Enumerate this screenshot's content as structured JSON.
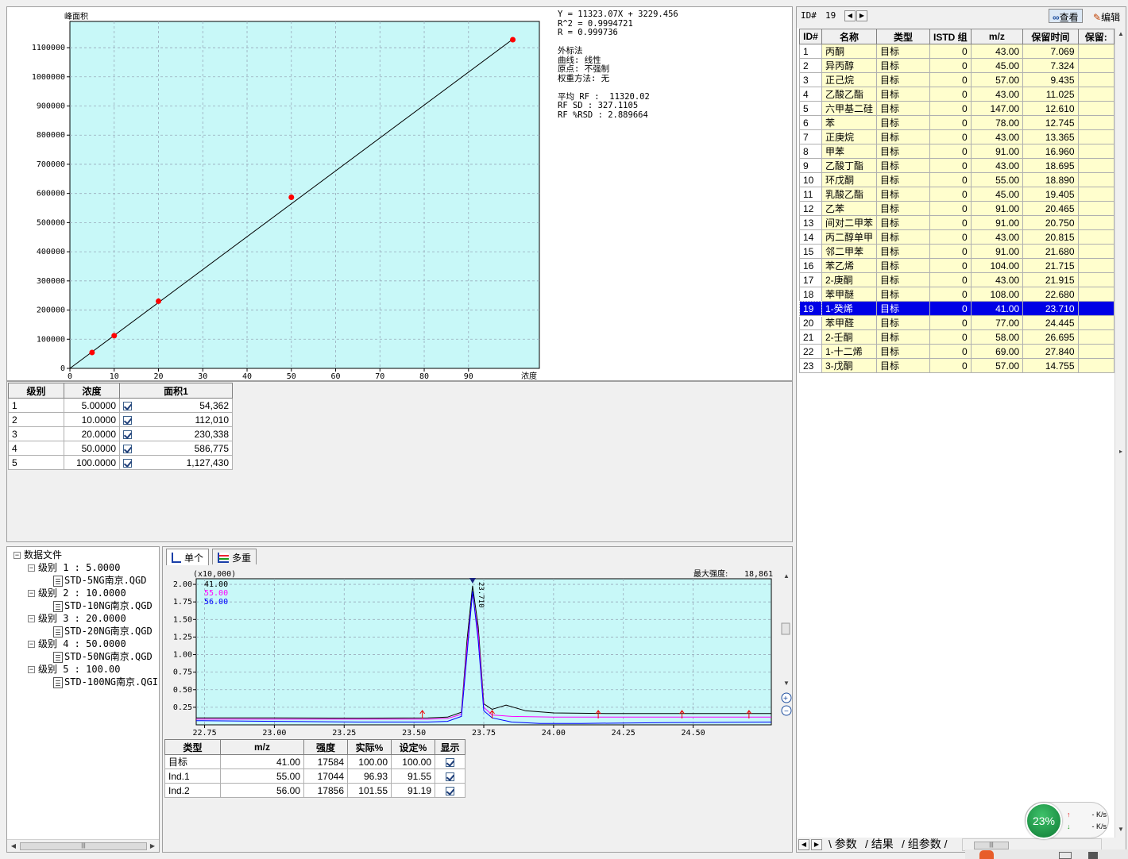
{
  "cal_chart": {
    "chart_data": {
      "type": "scatter",
      "ylabel": "峰面积",
      "xlabel": "浓度",
      "x_ticks": [
        "0",
        "10",
        "20",
        "30",
        "40",
        "50",
        "60",
        "70",
        "80",
        "90"
      ],
      "y_ticks": [
        "0",
        "100000",
        "200000",
        "300000",
        "400000",
        "500000",
        "600000",
        "700000",
        "800000",
        "900000",
        "1000000",
        "1100000"
      ],
      "xlim": [
        0,
        106
      ],
      "ylim": [
        0,
        1190000
      ],
      "grid": true,
      "points": [
        {
          "x": 5,
          "y": 54362
        },
        {
          "x": 10,
          "y": 112010
        },
        {
          "x": 20,
          "y": 230338
        },
        {
          "x": 50,
          "y": 586775
        },
        {
          "x": 100,
          "y": 1127430
        }
      ],
      "fit_line": {
        "slope": 11323.07,
        "intercept": -3229.456
      },
      "point_color": "#ff0000",
      "background_color": "#c8f8f8"
    }
  },
  "equation_info": [
    "Y = 11323.07X + 3229.456",
    "R^2 = 0.9994721",
    "R = 0.999736",
    "",
    "外标法",
    "曲线: 线性",
    "原点: 不强制",
    "权重方法: 无",
    "",
    "平均 RF :  11320.02",
    "RF SD : 327.1105",
    "RF %RSD : 2.889664"
  ],
  "level_table": {
    "headers": [
      "级别",
      "浓度",
      "面积1"
    ],
    "rows": [
      {
        "level": "1",
        "conc": "5.00000",
        "area": "54,362",
        "checked": true
      },
      {
        "level": "2",
        "conc": "10.0000",
        "area": "112,010",
        "checked": true
      },
      {
        "level": "3",
        "conc": "20.0000",
        "area": "230,338",
        "checked": true
      },
      {
        "level": "4",
        "conc": "50.0000",
        "area": "586,775",
        "checked": true
      },
      {
        "level": "5",
        "conc": "100.0000",
        "area": "1,127,430",
        "checked": true
      }
    ]
  },
  "tree": {
    "root": "数据文件",
    "levels": [
      {
        "label": "级别 1 : 5.0000",
        "file": "STD-5NG南京.QGD"
      },
      {
        "label": "级别 2 : 10.0000",
        "file": "STD-10NG南京.QGD"
      },
      {
        "label": "级别 3 : 20.0000",
        "file": "STD-20NG南京.QGD"
      },
      {
        "label": "级别 4 : 50.0000",
        "file": "STD-50NG南京.QGD"
      },
      {
        "label": "级别 5 : 100.00",
        "file": "STD-100NG南京.QGI"
      }
    ]
  },
  "chrom": {
    "tabs": [
      "单个",
      "多重"
    ],
    "scale_label": "(x10,000)",
    "max_intensity_label": "最大强度:",
    "max_intensity_value": "18,861",
    "peak_label": "23.710",
    "chart_data": {
      "type": "line",
      "xlim": [
        22.72,
        24.78
      ],
      "ylim": [
        0,
        2.08
      ],
      "x_ticks": [
        "22.75",
        "23.00",
        "23.25",
        "23.50",
        "23.75",
        "24.00",
        "24.25",
        "24.50"
      ],
      "y_ticks": [
        "0.25",
        "0.50",
        "0.75",
        "1.00",
        "1.25",
        "1.50",
        "1.75",
        "2.00"
      ],
      "background_color": "#c8f8f8",
      "series": [
        {
          "name": "41.00",
          "color": "#000000",
          "x": [
            22.72,
            23.0,
            23.3,
            23.55,
            23.62,
            23.67,
            23.69,
            23.71,
            23.73,
            23.75,
            23.78,
            23.83,
            23.9,
            24.0,
            24.2,
            24.4,
            24.6,
            24.78
          ],
          "y": [
            0.1,
            0.1,
            0.095,
            0.1,
            0.11,
            0.18,
            1.2,
            1.98,
            1.4,
            0.3,
            0.22,
            0.28,
            0.2,
            0.17,
            0.16,
            0.16,
            0.16,
            0.16
          ]
        },
        {
          "name": "55.00",
          "color": "#ff00ff",
          "x": [
            22.72,
            23.0,
            23.3,
            23.55,
            23.62,
            23.67,
            23.69,
            23.71,
            23.73,
            23.75,
            23.78,
            23.85,
            24.0,
            24.3,
            24.6,
            24.78
          ],
          "y": [
            0.08,
            0.08,
            0.08,
            0.08,
            0.09,
            0.15,
            1.1,
            1.88,
            1.3,
            0.25,
            0.14,
            0.12,
            0.11,
            0.11,
            0.11,
            0.11
          ]
        },
        {
          "name": "56.00",
          "color": "#0000ff",
          "x": [
            22.72,
            23.0,
            23.3,
            23.55,
            23.62,
            23.67,
            23.69,
            23.71,
            23.73,
            23.75,
            23.78,
            23.85,
            23.95,
            24.1,
            24.4,
            24.78
          ],
          "y": [
            0.06,
            0.05,
            0.04,
            0.04,
            0.05,
            0.12,
            1.0,
            1.9,
            1.2,
            0.2,
            0.1,
            0.04,
            0.02,
            0.02,
            0.03,
            0.04
          ]
        }
      ],
      "markers_x": [
        23.53,
        23.78,
        24.16,
        24.46,
        24.7
      ]
    },
    "ion_table": {
      "headers": [
        "类型",
        "m/z",
        "强度",
        "实际%",
        "设定%",
        "显示"
      ],
      "rows": [
        {
          "type": "目标",
          "mz": "41.00",
          "intensity": "17584",
          "actual": "100.00",
          "set": "100.00"
        },
        {
          "type": "Ind.1",
          "mz": "55.00",
          "intensity": "17044",
          "actual": "96.93",
          "set": "91.55"
        },
        {
          "type": "Ind.2",
          "mz": "56.00",
          "intensity": "17856",
          "actual": "101.55",
          "set": "91.19"
        }
      ]
    }
  },
  "right": {
    "id_label": "ID#",
    "id_value": "19",
    "view_button": "查看",
    "edit_button": "编辑",
    "headers": [
      "ID#",
      "名称",
      "类型",
      "ISTD 组",
      "m/z",
      "保留时间",
      "保留:"
    ],
    "rows": [
      [
        "1",
        "丙酮",
        "目标",
        "0",
        "43.00",
        "7.069"
      ],
      [
        "2",
        "异丙醇",
        "目标",
        "0",
        "45.00",
        "7.324"
      ],
      [
        "3",
        "正己烷",
        "目标",
        "0",
        "57.00",
        "9.435"
      ],
      [
        "4",
        "乙酸乙酯",
        "目标",
        "0",
        "43.00",
        "11.025"
      ],
      [
        "5",
        "六甲基二硅",
        "目标",
        "0",
        "147.00",
        "12.610"
      ],
      [
        "6",
        "苯",
        "目标",
        "0",
        "78.00",
        "12.745"
      ],
      [
        "7",
        "正庚烷",
        "目标",
        "0",
        "43.00",
        "13.365"
      ],
      [
        "8",
        "甲苯",
        "目标",
        "0",
        "91.00",
        "16.960"
      ],
      [
        "9",
        "乙酸丁酯",
        "目标",
        "0",
        "43.00",
        "18.695"
      ],
      [
        "10",
        "环戊酮",
        "目标",
        "0",
        "55.00",
        "18.890"
      ],
      [
        "11",
        "乳酸乙酯",
        "目标",
        "0",
        "45.00",
        "19.405"
      ],
      [
        "12",
        "乙苯",
        "目标",
        "0",
        "91.00",
        "20.465"
      ],
      [
        "13",
        "间对二甲苯",
        "目标",
        "0",
        "91.00",
        "20.750"
      ],
      [
        "14",
        "丙二醇单甲",
        "目标",
        "0",
        "43.00",
        "20.815"
      ],
      [
        "15",
        "邻二甲苯",
        "目标",
        "0",
        "91.00",
        "21.680"
      ],
      [
        "16",
        "苯乙烯",
        "目标",
        "0",
        "104.00",
        "21.715"
      ],
      [
        "17",
        "2-庚酮",
        "目标",
        "0",
        "43.00",
        "21.915"
      ],
      [
        "18",
        "苯甲醚",
        "目标",
        "0",
        "108.00",
        "22.680"
      ],
      [
        "19",
        "1-癸烯",
        "目标",
        "0",
        "41.00",
        "23.710"
      ],
      [
        "20",
        "苯甲醛",
        "目标",
        "0",
        "77.00",
        "24.445"
      ],
      [
        "21",
        "2-壬酮",
        "目标",
        "0",
        "58.00",
        "26.695"
      ],
      [
        "22",
        "1-十二烯",
        "目标",
        "0",
        "69.00",
        "27.840"
      ],
      [
        "23",
        "3-戊酮",
        "目标",
        "0",
        "57.00",
        "14.755"
      ]
    ],
    "selected_id": "19",
    "bottom_tabs": [
      "参数",
      "结果",
      "组参数"
    ],
    "selection_color": "#0000e6",
    "row_color": "#fffecd"
  },
  "tray": {
    "percent": "23%",
    "up_rate": "- K/s",
    "down_rate": "- K/s"
  }
}
